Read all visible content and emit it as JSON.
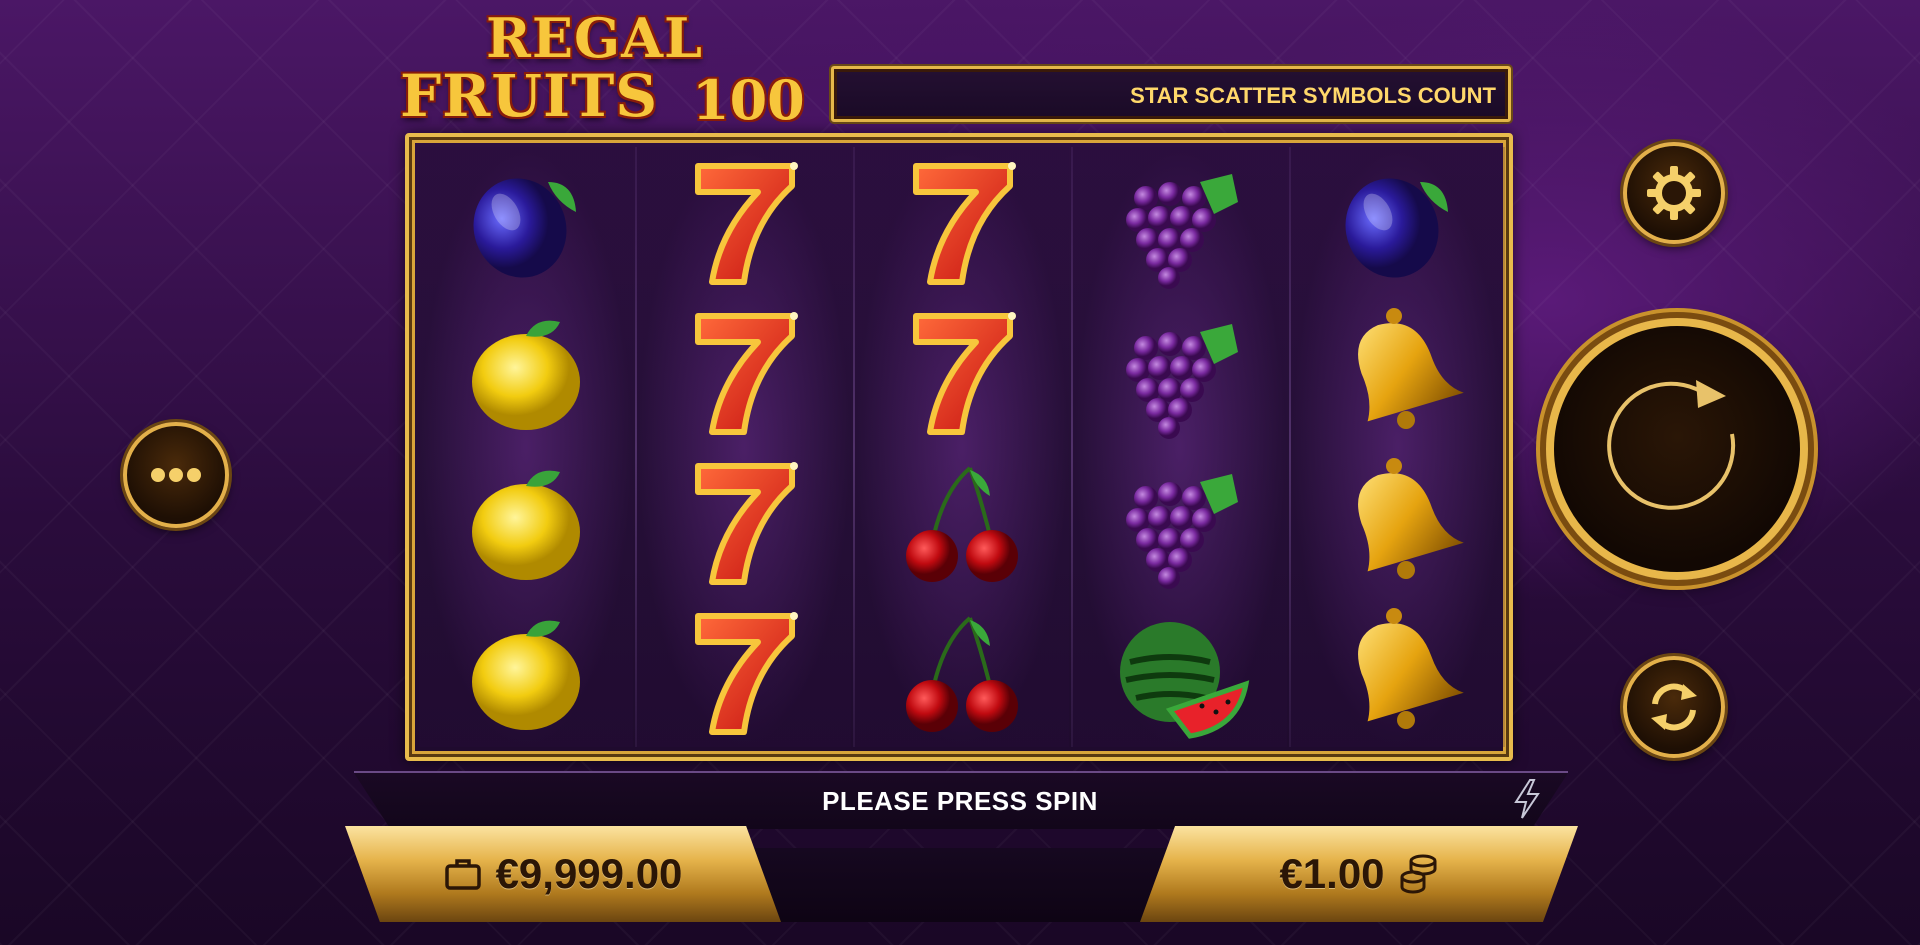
{
  "game": {
    "title_line1": "REGAL",
    "title_line2": "FRUITS",
    "title_number": "100"
  },
  "ticker": {
    "text": "STAR SCATTER SYMBOLS COUNT"
  },
  "reels": [
    [
      "plum",
      "lemon",
      "lemon",
      "lemon"
    ],
    [
      "seven",
      "seven",
      "seven",
      "seven"
    ],
    [
      "seven",
      "seven",
      "cherry",
      "cherry"
    ],
    [
      "grapes",
      "grapes",
      "grapes",
      "watermelon"
    ],
    [
      "plum",
      "bell",
      "bell",
      "bell"
    ]
  ],
  "message": {
    "text": "PLEASE PRESS SPIN"
  },
  "balance": {
    "amount": "€9,999.00",
    "icon": "wallet-icon"
  },
  "bet": {
    "amount": "€1.00",
    "icon": "coins-icon"
  },
  "controls": {
    "menu_icon": "more-dots-icon",
    "settings_icon": "gear-icon",
    "spin_icon": "spin-arrow-icon",
    "autoplay_icon": "autoplay-icon",
    "turbo_icon": "lightning-icon"
  },
  "colors": {
    "gold": "#e8bb4c",
    "bg_purple": "#4a1466"
  }
}
